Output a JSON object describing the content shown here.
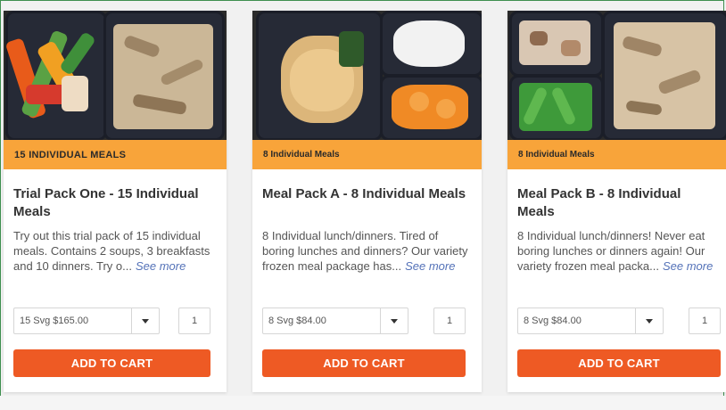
{
  "colors": {
    "ribbon": "#f8a43a",
    "button": "#ee5a24",
    "link": "#5472b8"
  },
  "products": [
    {
      "ribbon": "15 INDIVIDUAL MEALS",
      "title": "Trial Pack One - 15 Individual Meals",
      "description": "Try out this trial pack of 15 individual meals. Contains 2 soups, 3 breakfasts and 10 dinners. Try o...",
      "see_more": "See more",
      "option_selected": "15 Svg $165.00",
      "quantity": "1",
      "add_to_cart": "ADD TO CART"
    },
    {
      "ribbon": "8 Individual Meals",
      "title": "Meal Pack A - 8 Individual Meals",
      "description": "8 Individual lunch/dinners. Tired of boring lunches and dinners? Our variety frozen meal package has...",
      "see_more": "See more",
      "option_selected": "8 Svg $84.00",
      "quantity": "1",
      "add_to_cart": "ADD TO CART"
    },
    {
      "ribbon": "8 Individual Meals",
      "title": "Meal Pack B - 8 Individual Meals",
      "description": "8 Individual lunch/dinners! Never eat boring lunches or dinners again! Our variety frozen meal packa...",
      "see_more": "See more",
      "option_selected": "8 Svg $84.00",
      "quantity": "1",
      "add_to_cart": "ADD TO CART"
    }
  ]
}
